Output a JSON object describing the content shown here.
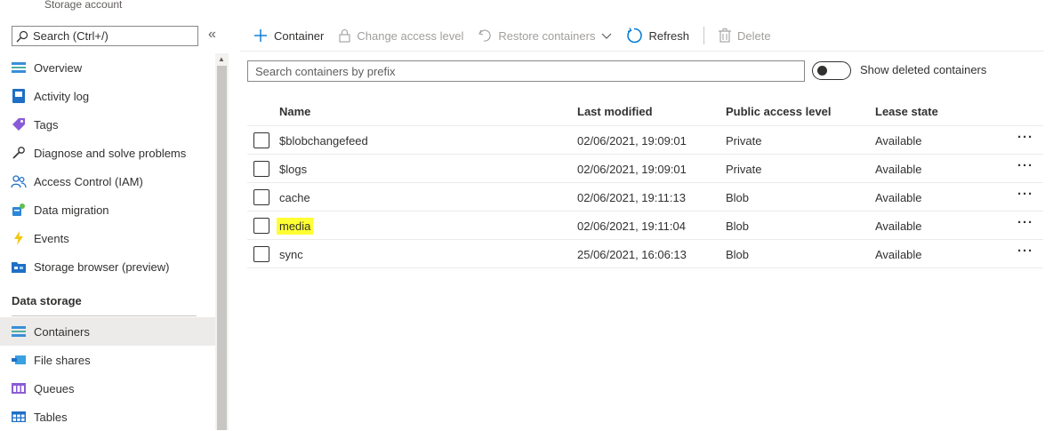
{
  "header": {
    "subtitle": "Storage account"
  },
  "sidebar": {
    "search_placeholder": "Search (Ctrl+/)",
    "collapse_glyph": "«",
    "items": [
      {
        "label": "Overview",
        "icon": "overview-icon"
      },
      {
        "label": "Activity log",
        "icon": "activity-log-icon"
      },
      {
        "label": "Tags",
        "icon": "tag-icon"
      },
      {
        "label": "Diagnose and solve problems",
        "icon": "wrench-icon"
      },
      {
        "label": "Access Control (IAM)",
        "icon": "people-icon"
      },
      {
        "label": "Data migration",
        "icon": "data-migration-icon"
      },
      {
        "label": "Events",
        "icon": "lightning-icon"
      },
      {
        "label": "Storage browser (preview)",
        "icon": "storage-browser-icon"
      }
    ],
    "section_header": "Data storage",
    "storage_items": [
      {
        "label": "Containers",
        "icon": "containers-icon",
        "selected": true
      },
      {
        "label": "File shares",
        "icon": "file-shares-icon"
      },
      {
        "label": "Queues",
        "icon": "queues-icon"
      },
      {
        "label": "Tables",
        "icon": "tables-icon"
      }
    ]
  },
  "toolbar": {
    "add_container_label": "Container",
    "change_access_label": "Change access level",
    "restore_label": "Restore containers",
    "refresh_label": "Refresh",
    "delete_label": "Delete"
  },
  "search": {
    "placeholder": "Search containers by prefix"
  },
  "toggle": {
    "label": "Show deleted containers",
    "on": false
  },
  "grid": {
    "columns": [
      "Name",
      "Last modified",
      "Public access level",
      "Lease state"
    ],
    "rows": [
      {
        "name": "$blobchangefeed",
        "modified": "02/06/2021, 19:09:01",
        "access": "Private",
        "lease": "Available"
      },
      {
        "name": "$logs",
        "modified": "02/06/2021, 19:09:01",
        "access": "Private",
        "lease": "Available"
      },
      {
        "name": "cache",
        "modified": "02/06/2021, 19:11:13",
        "access": "Blob",
        "lease": "Available"
      },
      {
        "name": "media",
        "modified": "02/06/2021, 19:11:04",
        "access": "Blob",
        "lease": "Available",
        "highlighted": true
      },
      {
        "name": "sync",
        "modified": "25/06/2021, 16:06:13",
        "access": "Blob",
        "lease": "Available"
      }
    ],
    "more_glyph": "···"
  },
  "colors": {
    "accent": "#0078d4",
    "highlight": "#ffff33",
    "selected_nav": "#edebe9"
  }
}
